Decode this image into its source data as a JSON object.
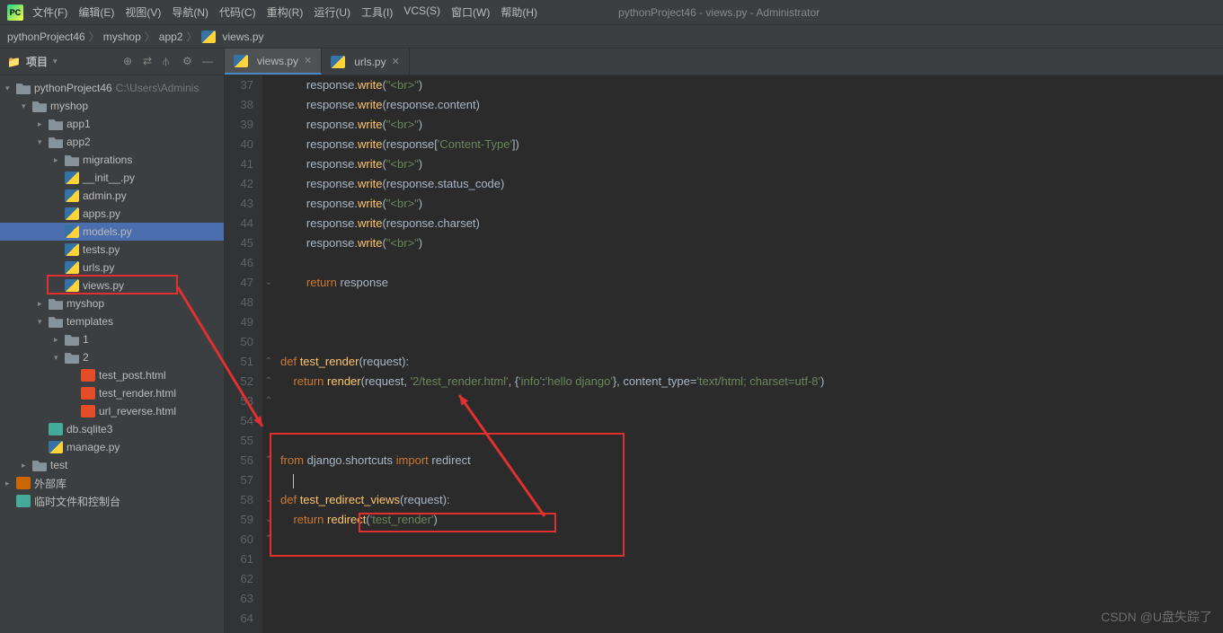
{
  "title": "pythonProject46 - views.py - Administrator",
  "menu": [
    "文件(F)",
    "编辑(E)",
    "视图(V)",
    "导航(N)",
    "代码(C)",
    "重构(R)",
    "运行(U)",
    "工具(I)",
    "VCS(S)",
    "窗口(W)",
    "帮助(H)"
  ],
  "breadcrumb": [
    "pythonProject46",
    "myshop",
    "app2",
    "views.py"
  ],
  "project_label": "项目",
  "tree": [
    {
      "d": 0,
      "arrow": "▾",
      "icon": "folder",
      "label": "pythonProject46",
      "path": "C:\\Users\\Adminis"
    },
    {
      "d": 1,
      "arrow": "▾",
      "icon": "folder",
      "label": "myshop"
    },
    {
      "d": 2,
      "arrow": "▸",
      "icon": "folder",
      "label": "app1"
    },
    {
      "d": 2,
      "arrow": "▾",
      "icon": "folder",
      "label": "app2"
    },
    {
      "d": 3,
      "arrow": "▸",
      "icon": "folder",
      "label": "migrations"
    },
    {
      "d": 3,
      "arrow": "",
      "icon": "py",
      "label": "__init__.py"
    },
    {
      "d": 3,
      "arrow": "",
      "icon": "py",
      "label": "admin.py"
    },
    {
      "d": 3,
      "arrow": "",
      "icon": "py",
      "label": "apps.py"
    },
    {
      "d": 3,
      "arrow": "",
      "icon": "py",
      "label": "models.py",
      "selected": true
    },
    {
      "d": 3,
      "arrow": "",
      "icon": "py",
      "label": "tests.py"
    },
    {
      "d": 3,
      "arrow": "",
      "icon": "py",
      "label": "urls.py"
    },
    {
      "d": 3,
      "arrow": "",
      "icon": "py",
      "label": "views.py",
      "boxed": true
    },
    {
      "d": 2,
      "arrow": "▸",
      "icon": "folder",
      "label": "myshop"
    },
    {
      "d": 2,
      "arrow": "▾",
      "icon": "folder",
      "label": "templates"
    },
    {
      "d": 3,
      "arrow": "▸",
      "icon": "folder",
      "label": "1"
    },
    {
      "d": 3,
      "arrow": "▾",
      "icon": "folder",
      "label": "2"
    },
    {
      "d": 4,
      "arrow": "",
      "icon": "html",
      "label": "test_post.html"
    },
    {
      "d": 4,
      "arrow": "",
      "icon": "html",
      "label": "test_render.html"
    },
    {
      "d": 4,
      "arrow": "",
      "icon": "html",
      "label": "url_reverse.html"
    },
    {
      "d": 2,
      "arrow": "",
      "icon": "db",
      "label": "db.sqlite3"
    },
    {
      "d": 2,
      "arrow": "",
      "icon": "py",
      "label": "manage.py"
    },
    {
      "d": 1,
      "arrow": "▸",
      "icon": "folder",
      "label": "test"
    },
    {
      "d": 0,
      "arrow": "▸",
      "icon": "lib",
      "label": "外部库"
    },
    {
      "d": 0,
      "arrow": "",
      "icon": "console",
      "label": "临时文件和控制台"
    }
  ],
  "tabs": [
    {
      "label": "views.py",
      "active": true
    },
    {
      "label": "urls.py",
      "active": false
    }
  ],
  "gutter_start": 37,
  "code": [
    [
      [
        "ident",
        "        response"
      ],
      [
        "punct",
        "."
      ],
      [
        "fn",
        "write"
      ],
      [
        "punct",
        "("
      ],
      [
        "str",
        "\"<br>\""
      ],
      [
        "punct",
        ")"
      ]
    ],
    [
      [
        "ident",
        "        response"
      ],
      [
        "punct",
        "."
      ],
      [
        "fn",
        "write"
      ],
      [
        "punct",
        "("
      ],
      [
        "ident",
        "response"
      ],
      [
        "punct",
        "."
      ],
      [
        "ident",
        "content"
      ],
      [
        "punct",
        ")"
      ]
    ],
    [
      [
        "ident",
        "        response"
      ],
      [
        "punct",
        "."
      ],
      [
        "fn",
        "write"
      ],
      [
        "punct",
        "("
      ],
      [
        "str",
        "\"<br>\""
      ],
      [
        "punct",
        ")"
      ]
    ],
    [
      [
        "ident",
        "        response"
      ],
      [
        "punct",
        "."
      ],
      [
        "fn",
        "write"
      ],
      [
        "punct",
        "("
      ],
      [
        "ident",
        "response"
      ],
      [
        "punct",
        "["
      ],
      [
        "str",
        "'Content-Type'"
      ],
      [
        "punct",
        "])"
      ]
    ],
    [
      [
        "ident",
        "        response"
      ],
      [
        "punct",
        "."
      ],
      [
        "fn",
        "write"
      ],
      [
        "punct",
        "("
      ],
      [
        "str",
        "\"<br>\""
      ],
      [
        "punct",
        ")"
      ]
    ],
    [
      [
        "ident",
        "        response"
      ],
      [
        "punct",
        "."
      ],
      [
        "fn",
        "write"
      ],
      [
        "punct",
        "("
      ],
      [
        "ident",
        "response"
      ],
      [
        "punct",
        "."
      ],
      [
        "ident",
        "status_code"
      ],
      [
        "punct",
        ")"
      ]
    ],
    [
      [
        "ident",
        "        response"
      ],
      [
        "punct",
        "."
      ],
      [
        "fn",
        "write"
      ],
      [
        "punct",
        "("
      ],
      [
        "str",
        "\"<br>\""
      ],
      [
        "punct",
        ")"
      ]
    ],
    [
      [
        "ident",
        "        response"
      ],
      [
        "punct",
        "."
      ],
      [
        "fn",
        "write"
      ],
      [
        "punct",
        "("
      ],
      [
        "ident",
        "response"
      ],
      [
        "punct",
        "."
      ],
      [
        "ident",
        "charset"
      ],
      [
        "punct",
        ")"
      ]
    ],
    [
      [
        "ident",
        "        response"
      ],
      [
        "punct",
        "."
      ],
      [
        "fn",
        "write"
      ],
      [
        "punct",
        "("
      ],
      [
        "str",
        "\"<br>\""
      ],
      [
        "punct",
        ")"
      ]
    ],
    [],
    [
      [
        "kw",
        "        return "
      ],
      [
        "ident",
        "response"
      ]
    ],
    [],
    [],
    [],
    [
      [
        "kw",
        "def "
      ],
      [
        "fn",
        "test_render"
      ],
      [
        "punct",
        "("
      ],
      [
        "param",
        "request"
      ],
      [
        "punct",
        "):"
      ]
    ],
    [
      [
        "kw",
        "    return "
      ],
      [
        "fn",
        "render"
      ],
      [
        "punct",
        "("
      ],
      [
        "ident",
        "request"
      ],
      [
        "punct",
        ", "
      ],
      [
        "str",
        "'2/test_render.html'"
      ],
      [
        "punct",
        ", {"
      ],
      [
        "str",
        "'info'"
      ],
      [
        "punct",
        ":"
      ],
      [
        "str",
        "'hello django'"
      ],
      [
        "punct",
        "}, "
      ],
      [
        "param",
        "content_type"
      ],
      [
        "punct",
        "="
      ],
      [
        "str",
        "'text/html; charset=utf-8'"
      ],
      [
        "punct",
        ")"
      ]
    ],
    [],
    [],
    [],
    [
      [
        "kw",
        "from "
      ],
      [
        "ident",
        "django"
      ],
      [
        "punct",
        "."
      ],
      [
        "ident",
        "shortcuts"
      ],
      [
        "kw",
        " import "
      ],
      [
        "ident",
        "redirect"
      ]
    ],
    [
      [
        "ident",
        "    "
      ],
      [
        "punct",
        ""
      ]
    ],
    [
      [
        "kw",
        "def "
      ],
      [
        "fn",
        "test_redirect_views"
      ],
      [
        "punct",
        "("
      ],
      [
        "param",
        "request"
      ],
      [
        "punct",
        "):"
      ]
    ],
    [
      [
        "kw",
        "    return "
      ],
      [
        "fn",
        "redirect"
      ],
      [
        "punct",
        "("
      ],
      [
        "str",
        "'test_render'"
      ],
      [
        "punct",
        ")"
      ]
    ],
    [],
    [],
    [],
    [],
    []
  ],
  "fold_marks": {
    "10": "⌄",
    "14": "⌃",
    "15": "⌃",
    "16": "⌃",
    "19": "⌃",
    "21": "⌄",
    "22": "⌄",
    "23": "⌃"
  },
  "watermark": "CSDN @U盘失踪了",
  "logo_text": "PC"
}
